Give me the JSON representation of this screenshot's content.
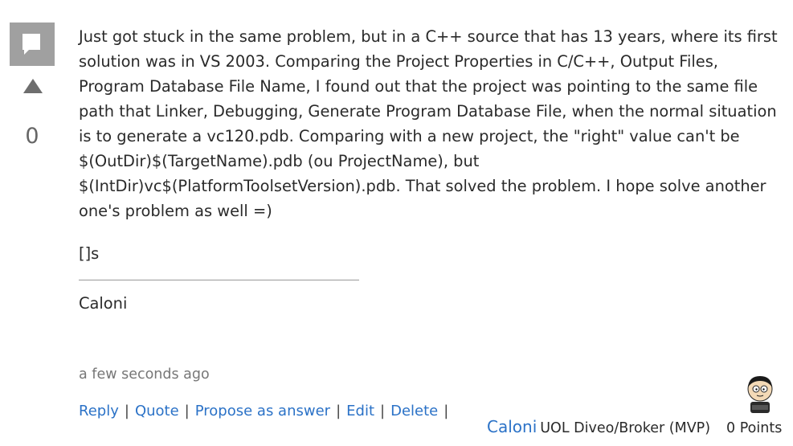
{
  "vote": {
    "count": "0"
  },
  "post": {
    "body": "Just got stuck in the same problem, but in a C++ source that has 13 years, where its first solution was in VS 2003. Comparing the Project Properties in C/C++, Output Files, Program Database File Name, I found out that the project was pointing to the same file path that Linker, Debugging, Generate Program Database File, when the normal situation is to generate a vc120.pdb. Comparing with a new project, the \"right\" value can't be $(OutDir)$(TargetName).pdb (ou ProjectName), but $(IntDir)vc$(PlatformToolsetVersion).pdb. That solved the problem. I hope solve another one's problem as well =)",
    "signoff": "[]s",
    "signature": "Caloni",
    "timestamp": "a few seconds ago"
  },
  "actions": {
    "reply": "Reply",
    "quote": "Quote",
    "propose": "Propose as answer",
    "edit": "Edit",
    "delete": "Delete",
    "separator": "|"
  },
  "author": {
    "name": "Caloni",
    "affiliation": "UOL Diveo/Broker (MVP)",
    "points": "0 Points"
  },
  "colors": {
    "link": "#2b72c7",
    "text": "#2a2a2a",
    "muted": "#777777",
    "icon_gray": "#a0a0a0"
  }
}
